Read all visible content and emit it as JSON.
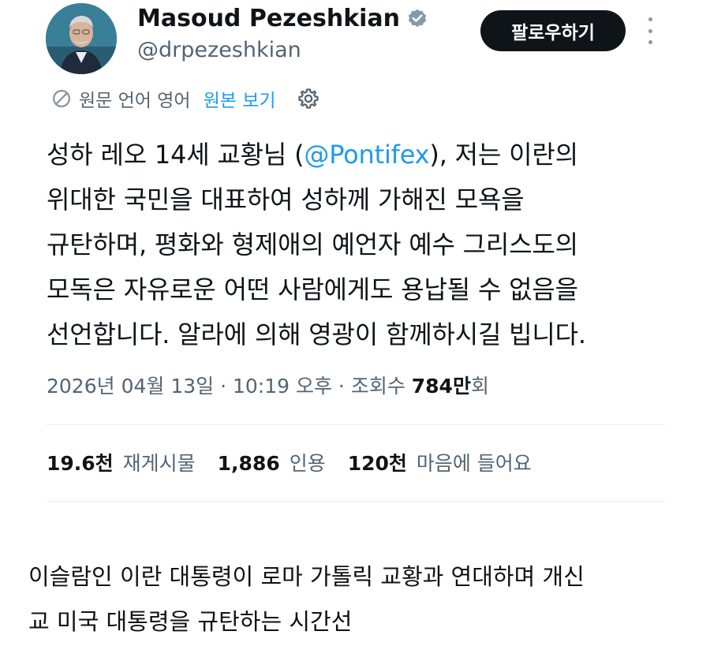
{
  "author": {
    "display_name": "Masoud Pezeshkian",
    "handle": "@drpezeshkian",
    "verified": true,
    "follow_label": "팔로우하기"
  },
  "translation": {
    "note": "원문 언어 영어",
    "show_original_label": "원본 보기"
  },
  "tweet": {
    "lines": [
      {
        "before": "성하 레오 14세 교황님 (",
        "mention": "@Pontifex",
        "after": "), 저는 이란의"
      },
      {
        "text": "위대한 국민을 대표하여 성하께 가해진 모욕을"
      },
      {
        "text": "규탄하며, 평화와 형제애의 예언자 예수 그리스도의"
      },
      {
        "text": "모독은 자유로운 어떤 사람에게도 용납될 수 없음을"
      },
      {
        "text": "선언합니다. 알라에 의해 영광이 함께하시길 빕니다."
      }
    ],
    "timestamp": "2026년 04월 13일 · 10:19 오후 · 조회수 ",
    "views_count": "784만",
    "views_suffix": "회"
  },
  "stats": {
    "reposts": {
      "count": "19.6천",
      "label": "재게시물"
    },
    "quotes": {
      "count": "1,886",
      "label": "인용"
    },
    "likes": {
      "count": "120천",
      "label": "마음에 들어요"
    }
  },
  "caption": {
    "lines": [
      "이슬람인 이란 대통령이 로마 가톨릭 교황과 연대하며 개신",
      "교 미국 대통령을 규탄하는 시간선"
    ]
  },
  "colors": {
    "link": "#1d9bf0",
    "secondary_text": "#536471",
    "primary_text": "#0f1419",
    "follow_button": "#0f1419"
  },
  "icons": {
    "verified": "verified-badge-icon",
    "translate": "translate-icon",
    "settings": "gear-icon",
    "more": "more-options-icon"
  }
}
